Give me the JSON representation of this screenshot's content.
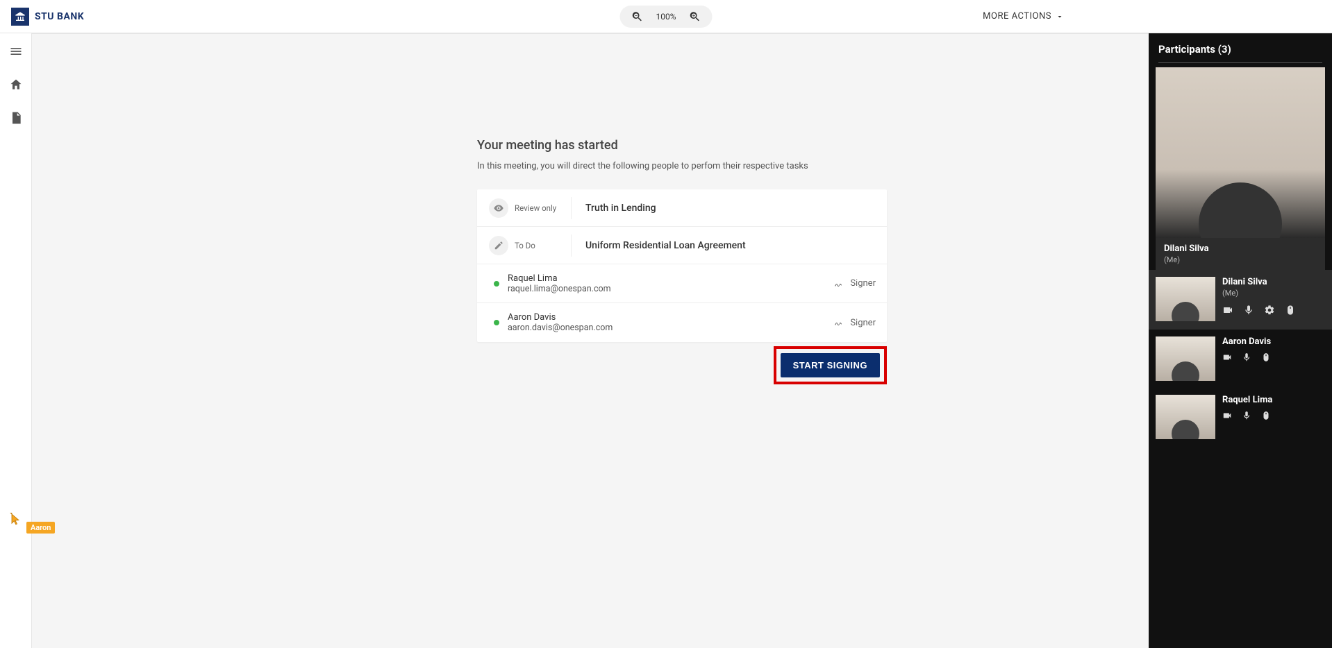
{
  "brand": {
    "name": "STU BANK"
  },
  "zoom": {
    "level": "100%"
  },
  "moreActions": "MORE ACTIONS",
  "meeting": {
    "title": "Your meeting has started",
    "subtitle": "In this meeting, you will direct the following people to perfom their respective tasks",
    "tasks": [
      {
        "status": "Review only",
        "doc": "Truth in Lending"
      },
      {
        "status": "To Do",
        "doc": "Uniform Residential Loan Agreement"
      }
    ],
    "signers": [
      {
        "name": "Raquel Lima",
        "email": "raquel.lima@onespan.com",
        "role": "Signer"
      },
      {
        "name": "Aaron Davis",
        "email": "aaron.davis@onespan.com",
        "role": "Signer"
      }
    ],
    "startButton": "START SIGNING"
  },
  "participants": {
    "header": "Participants (3)",
    "featured": {
      "name": "Dilani Silva",
      "sub": "(Me)"
    },
    "list": [
      {
        "name": "Dilani Silva",
        "sub": "(Me)"
      },
      {
        "name": "Aaron Davis"
      },
      {
        "name": "Raquel Lima"
      }
    ]
  },
  "remoteCursor": {
    "label": "Aaron"
  }
}
